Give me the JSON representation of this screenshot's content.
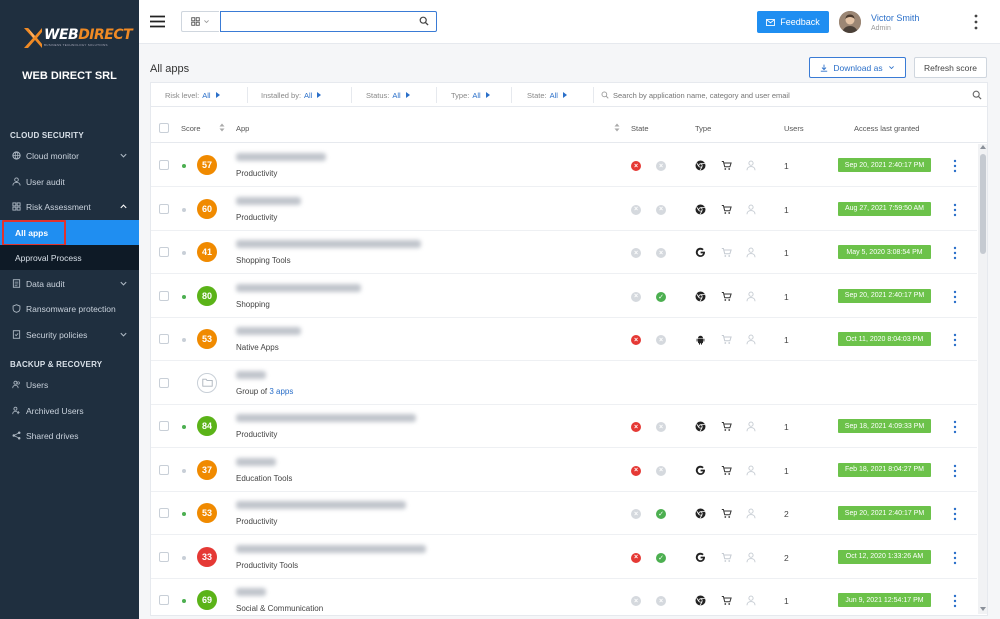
{
  "brand": {
    "logo_text_a": "WEB",
    "logo_text_b": "DIRECT",
    "logo_tagline": "BUSINESS TECHNOLOGY SOLUTIONS",
    "company": "WEB DIRECT SRL"
  },
  "sidebar": {
    "cloud_security_title": "CLOUD SECURITY",
    "backup_title": "BACKUP & RECOVERY",
    "items": {
      "cloud_monitor": "Cloud monitor",
      "user_audit": "User audit",
      "risk_assessment": "Risk Assessment",
      "all_apps": "All apps",
      "approval_process": "Approval Process",
      "data_audit": "Data audit",
      "ransomware": "Ransomware protection",
      "security_policies": "Security policies",
      "users": "Users",
      "archived_users": "Archived Users",
      "shared_drives": "Shared drives"
    }
  },
  "topbar": {
    "search_value": "",
    "feedback_label": "Feedback",
    "user_name": "Victor Smith",
    "user_role": "Admin"
  },
  "page": {
    "title": "All apps",
    "download_label": "Download as",
    "refresh_label": "Refresh score"
  },
  "filters": {
    "risk_level": {
      "label": "Risk level:",
      "value": "All"
    },
    "installed_by": {
      "label": "Installed by:",
      "value": "All"
    },
    "status": {
      "label": "Status:",
      "value": "All"
    },
    "type": {
      "label": "Type:",
      "value": "All"
    },
    "state": {
      "label": "State:",
      "value": "All"
    },
    "search_placeholder": "Search by application name, category and user email"
  },
  "table": {
    "headers": {
      "score": "Score",
      "app": "App",
      "state": "State",
      "type": "Type",
      "users": "Users",
      "access": "Access last granted"
    },
    "group_link": "3 apps",
    "group_prefix": "Group of ",
    "rows": [
      {
        "score": "57",
        "score_color": "#f08a00",
        "dot": "#4caf50",
        "category": "Productivity",
        "state1": "red",
        "state2": "grey",
        "type1": "chrome",
        "cart": true,
        "users": "1",
        "granted": "Sep 20, 2021 2:40:17 PM"
      },
      {
        "score": "60",
        "score_color": "#f08a00",
        "dot": "#c8cfd7",
        "category": "Productivity",
        "state1": "grey",
        "state2": "grey",
        "type1": "chrome",
        "cart": true,
        "users": "1",
        "granted": "Aug 27, 2021 7:59:50 AM"
      },
      {
        "score": "41",
        "score_color": "#f08a00",
        "dot": "#c8cfd7",
        "category": "Shopping Tools",
        "state1": "grey",
        "state2": "grey",
        "type1": "google",
        "cart": false,
        "users": "1",
        "granted": "May 5, 2020 3:08:54 PM"
      },
      {
        "score": "80",
        "score_color": "#5bb318",
        "dot": "#4caf50",
        "category": "Shopping",
        "state1": "grey",
        "state2": "green",
        "type1": "chrome",
        "cart": true,
        "users": "1",
        "granted": "Sep 20, 2021 2:40:17 PM"
      },
      {
        "score": "53",
        "score_color": "#f08a00",
        "dot": "#c8cfd7",
        "category": "Native Apps",
        "state1": "red",
        "state2": "grey",
        "type1": "android",
        "cart": false,
        "users": "1",
        "granted": "Oct 11, 2020 8:04:03 PM"
      },
      {
        "group": true,
        "category": "Group of"
      },
      {
        "score": "84",
        "score_color": "#5bb318",
        "dot": "#4caf50",
        "category": "Productivity",
        "state1": "red",
        "state2": "grey",
        "type1": "chrome",
        "cart": true,
        "users": "1",
        "granted": "Sep 18, 2021 4:09:33 PM"
      },
      {
        "score": "37",
        "score_color": "#f08a00",
        "dot": "#c8cfd7",
        "category": "Education Tools",
        "state1": "red",
        "state2": "grey",
        "type1": "google",
        "cart": true,
        "users": "1",
        "granted": "Feb 18, 2021 8:04:27 PM"
      },
      {
        "score": "53",
        "score_color": "#f08a00",
        "dot": "#4caf50",
        "category": "Productivity",
        "state1": "grey",
        "state2": "green",
        "type1": "chrome",
        "cart": true,
        "users": "2",
        "granted": "Sep 20, 2021 2:40:17 PM"
      },
      {
        "score": "33",
        "score_color": "#e53935",
        "dot": "#c8cfd7",
        "category": "Productivity Tools",
        "state1": "red",
        "state2": "green",
        "type1": "google",
        "cart": false,
        "users": "2",
        "granted": "Oct 12, 2020 1:33:26 AM"
      },
      {
        "score": "69",
        "score_color": "#5bb318",
        "dot": "#4caf50",
        "category": "Social & Communication",
        "state1": "grey",
        "state2": "grey",
        "type1": "chrome",
        "cart": true,
        "users": "1",
        "granted": "Jun 9, 2021 12:54:17 PM"
      }
    ]
  }
}
